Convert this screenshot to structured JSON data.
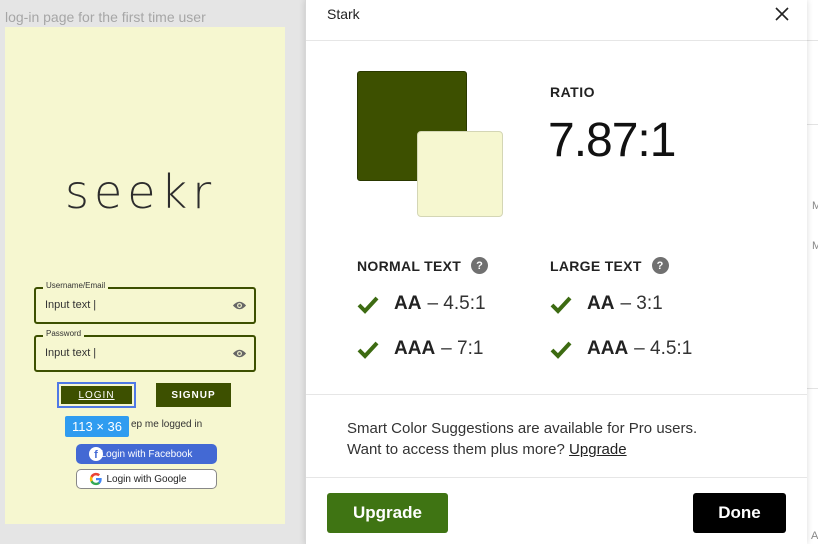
{
  "canvas": {
    "frame_title": "log-in page for the first time user",
    "logo_text": "seekr",
    "username": {
      "label": "Username/Email",
      "value": "Input text |"
    },
    "password": {
      "label": "Password",
      "value": "Input text |"
    },
    "login_label": "LOGIN",
    "signup_label": "SIGNUP",
    "dimension_badge": "113 × 36",
    "keep_logged_in": "ep me logged in",
    "facebook_label": "Login with Facebook",
    "facebook_glyph": "f",
    "google_label": "Login with Google"
  },
  "panel": {
    "title": "Stark",
    "foreground_color": "#3d5000",
    "background_color": "#f6f7d0",
    "ratio_label": "RATIO",
    "ratio_value": "7.87:1",
    "help_glyph": "?",
    "normal_text": {
      "heading": "NORMAL TEXT",
      "rows": [
        {
          "level": "AA",
          "threshold": "– 4.5:1",
          "pass": true
        },
        {
          "level": "AAA",
          "threshold": "– 7:1",
          "pass": true
        }
      ]
    },
    "large_text": {
      "heading": "LARGE TEXT",
      "rows": [
        {
          "level": "AA",
          "threshold": "– 3:1",
          "pass": true
        },
        {
          "level": "AAA",
          "threshold": "– 4.5:1",
          "pass": true
        }
      ]
    },
    "promo_line1": "Smart Color Suggestions are available for Pro users.",
    "promo_line2": "Want to access them plus more?",
    "promo_link": "Upgrade",
    "upgrade_button": "Upgrade",
    "done_button": "Done",
    "accent_green": "#3f7413"
  },
  "right_sliver": {
    "chars": [
      "M",
      "M",
      "A",
      "A"
    ]
  }
}
